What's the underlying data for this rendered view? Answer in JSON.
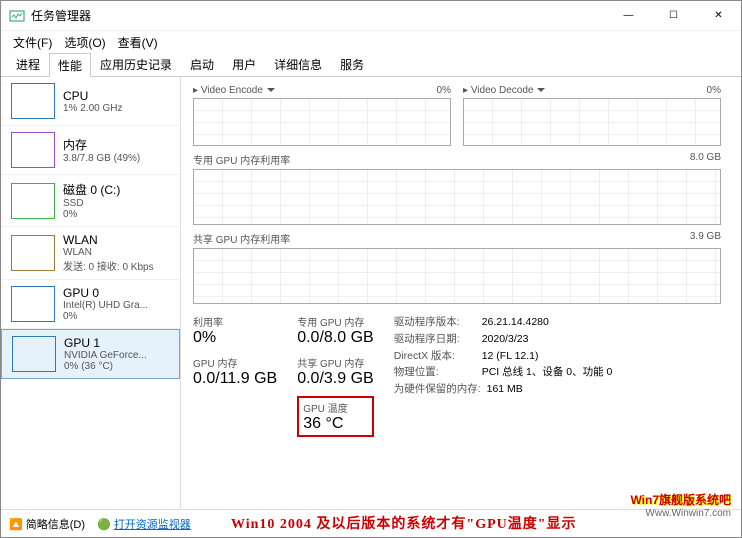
{
  "window": {
    "title": "任务管理器",
    "min": "—",
    "max": "☐",
    "close": "✕"
  },
  "menu": {
    "file": "文件(F)",
    "options": "选项(O)",
    "view": "查看(V)"
  },
  "tabs": [
    "进程",
    "性能",
    "应用历史记录",
    "启动",
    "用户",
    "详细信息",
    "服务"
  ],
  "activeTab": 1,
  "sidebar": [
    {
      "title": "CPU",
      "sub1": "1% 2.00 GHz",
      "color": "#2c7bb6"
    },
    {
      "title": "内存",
      "sub1": "3.8/7.8 GB (49%)",
      "color": "#9b4fc4"
    },
    {
      "title": "磁盘 0 (C:)",
      "sub1": "SSD",
      "sub2": "0%",
      "color": "#3fae49"
    },
    {
      "title": "WLAN",
      "sub1": "WLAN",
      "sub2": "发送: 0 接收: 0 Kbps",
      "color": "#a37a3b"
    },
    {
      "title": "GPU 0",
      "sub1": "Intel(R) UHD Gra...",
      "sub2": "0%",
      "color": "#2c7bb6"
    },
    {
      "title": "GPU 1",
      "sub1": "NVIDIA GeForce...",
      "sub2": "0% (36 °C)",
      "color": "#2c7bb6",
      "selected": true
    }
  ],
  "graphs": {
    "videoEncode": {
      "label": "Video Encode",
      "pct": "0%"
    },
    "videoDecode": {
      "label": "Video Decode",
      "pct": "0%"
    },
    "dedicated": {
      "label": "专用 GPU 内存利用率",
      "max": "8.0 GB"
    },
    "shared": {
      "label": "共享 GPU 内存利用率",
      "max": "3.9 GB"
    }
  },
  "stats": {
    "util": {
      "label": "利用率",
      "value": "0%"
    },
    "dedMem": {
      "label": "专用 GPU 内存",
      "value": "0.0/8.0 GB"
    },
    "gpuMem": {
      "label": "GPU 内存",
      "value": "0.0/11.9 GB"
    },
    "sharedMem": {
      "label": "共享 GPU 内存",
      "value": "0.0/3.9 GB"
    },
    "temp": {
      "label": "GPU 温度",
      "value": "36 °C"
    }
  },
  "meta": {
    "driverVer": {
      "k": "驱动程序版本:",
      "v": "26.21.14.4280"
    },
    "driverDate": {
      "k": "驱动程序日期:",
      "v": "2020/3/23"
    },
    "directx": {
      "k": "DirectX 版本:",
      "v": "12 (FL 12.1)"
    },
    "location": {
      "k": "物理位置:",
      "v": "PCI 总线 1、设备 0、功能 0"
    },
    "reserved": {
      "k": "为硬件保留的内存:",
      "v": "161 MB"
    }
  },
  "footer": {
    "brief": "简略信息(D)",
    "resmon": "打开资源监视器"
  },
  "annotation": "Win10 2004 及以后版本的系统才有\"GPU温度\"显示",
  "watermark": {
    "l1": "Win7旗舰版系统吧",
    "l2": "Www.Winwin7.com"
  }
}
